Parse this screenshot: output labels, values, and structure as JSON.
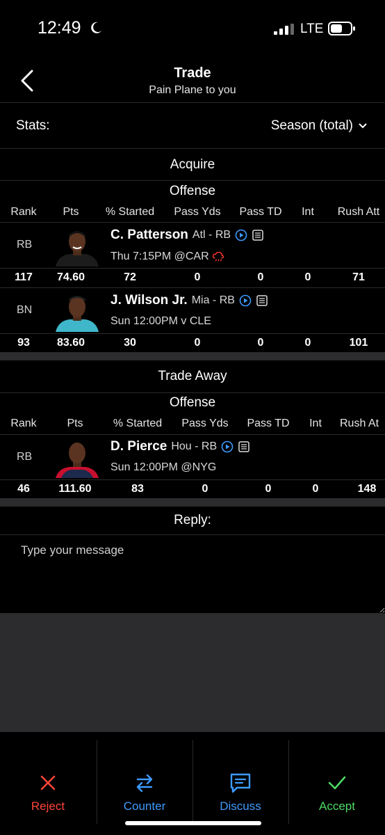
{
  "status_bar": {
    "time": "12:49",
    "network": "LTE"
  },
  "header": {
    "title": "Trade",
    "subtitle": "Pain Plane to you"
  },
  "stats": {
    "label": "Stats:",
    "value": "Season (total)"
  },
  "acquire": {
    "title": "Acquire",
    "group": "Offense",
    "columns": [
      "Rank",
      "Pts",
      "% Started",
      "Pass Yds",
      "Pass TD",
      "Int",
      "Rush Att"
    ],
    "players": [
      {
        "slot": "RB",
        "name": "C. Patterson",
        "team_pos": "Atl - RB",
        "game": "Thu 7:15PM @CAR",
        "stats": [
          "117",
          "74.60",
          "72",
          "0",
          "0",
          "0",
          "71"
        ]
      },
      {
        "slot": "BN",
        "name": "J. Wilson Jr.",
        "team_pos": "Mia - RB",
        "game": "Sun 12:00PM v CLE",
        "stats": [
          "93",
          "83.60",
          "30",
          "0",
          "0",
          "0",
          "101"
        ]
      }
    ]
  },
  "trade_away": {
    "title": "Trade Away",
    "group": "Offense",
    "columns": [
      "Rank",
      "Pts",
      "% Started",
      "Pass Yds",
      "Pass TD",
      "Int",
      "Rush At"
    ],
    "players": [
      {
        "slot": "RB",
        "name": "D. Pierce",
        "team_pos": "Hou - RB",
        "game": "Sun 12:00PM @NYG",
        "stats": [
          "46",
          "111.60",
          "83",
          "0",
          "0",
          "0",
          "148"
        ]
      }
    ]
  },
  "reply": {
    "title": "Reply:",
    "placeholder": "Type your message"
  },
  "actions": [
    {
      "label": "Reject",
      "icon": "close-icon",
      "color": "#ff453a"
    },
    {
      "label": "Counter",
      "icon": "swap-arrows-icon",
      "color": "#3d9bff"
    },
    {
      "label": "Discuss",
      "icon": "chat-bubble-icon",
      "color": "#3d9bff"
    },
    {
      "label": "Accept",
      "icon": "checkmark-icon",
      "color": "#4cd964"
    }
  ],
  "colors": {
    "background": "#000000",
    "bar": "#2c2c2e",
    "weather_alert": "#ff3b30",
    "play_icon": "#3d9bff"
  }
}
